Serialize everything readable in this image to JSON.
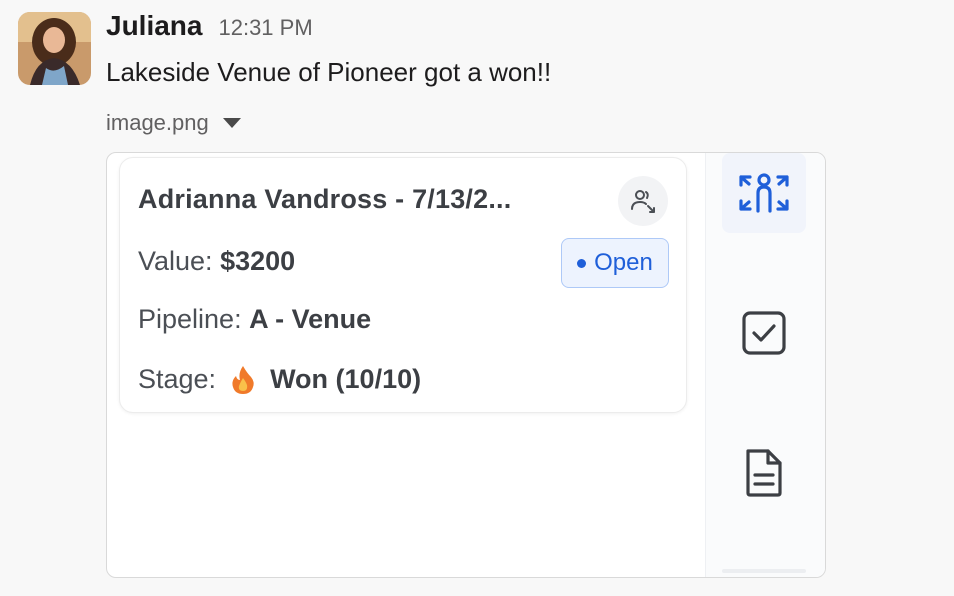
{
  "message": {
    "username": "Juliana",
    "timestamp": "12:31 PM",
    "text": "Lakeside Venue of Pioneer got a won!!"
  },
  "attachment": {
    "filename": "image.png"
  },
  "card": {
    "title": "Adrianna Vandross - 7/13/2...",
    "value_label": "Value:",
    "value": "$3200",
    "status": "Open",
    "pipeline_label": "Pipeline:",
    "pipeline": "A - Venue",
    "stage_label": "Stage:",
    "stage": "Won (10/10)",
    "stage_icon": "fire-icon"
  },
  "sidebar": {
    "items": [
      {
        "icon": "expand-contact-icon",
        "active": true
      },
      {
        "icon": "checkbox-icon",
        "active": false
      },
      {
        "icon": "document-icon",
        "active": false
      }
    ]
  },
  "colors": {
    "accent": "#1f5fd9",
    "status_bg": "#edf3fe",
    "status_border": "#aec9f7",
    "fire": "#f07a2a"
  }
}
